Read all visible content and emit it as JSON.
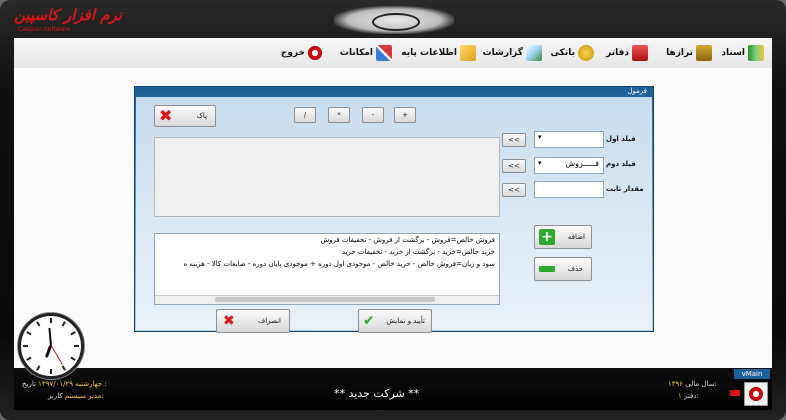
{
  "brand": {
    "name": "نرم افزار کاسپین",
    "subtitle": "Caspian Software"
  },
  "menu": {
    "items": [
      "اسناد",
      "ترازها",
      "دفاتر",
      "بانکی",
      "گزارشات",
      "اطلاعات پایه",
      "امکانات",
      "خروج"
    ]
  },
  "dialog": {
    "title": "فرمول",
    "operators": [
      "+",
      "-",
      "*",
      "/"
    ],
    "clear_label": "پاک",
    "field1_label": "فیلد اول",
    "field2_label": "فیلد دوم",
    "constant_label": "مقدار ثابت",
    "field2_value": "فـــــروش",
    "arrow_btn": "<<",
    "add_label": "اضافه",
    "delete_label": "حذف",
    "cancel_label": "انصراف",
    "confirm_label": "تأیید و نمایش",
    "formula_lines": [
      "فروش خالص=فروش - برگشت از فروش  - تخفیفات فروش",
      "خرید خالص=خرید - برگشت از خرید - تخفیفات خرید",
      "سود و زیان=فروش خالص - خرید خالص - موجودی اول دوره + موجودی پایان دوره - ضایعات کالا - هزینه ه"
    ]
  },
  "status": {
    "company": "** شرکت جدید **",
    "date_label": "تاریخ :",
    "date_value": "جهارشنبه ۱۳۹۷/۰۱/۲۹",
    "user_label": "کاربر:",
    "user_value": "مدیر سیستم",
    "fiscal_label": "سال مالی:",
    "fiscal_value": "۱۳۹۶",
    "book_label": "دفتر:",
    "book_value": "۱",
    "form_name": "vMain"
  },
  "colors": {
    "accent": "#1d5f97",
    "brand_red": "#d81515",
    "status_yellow": "#f5c542"
  }
}
